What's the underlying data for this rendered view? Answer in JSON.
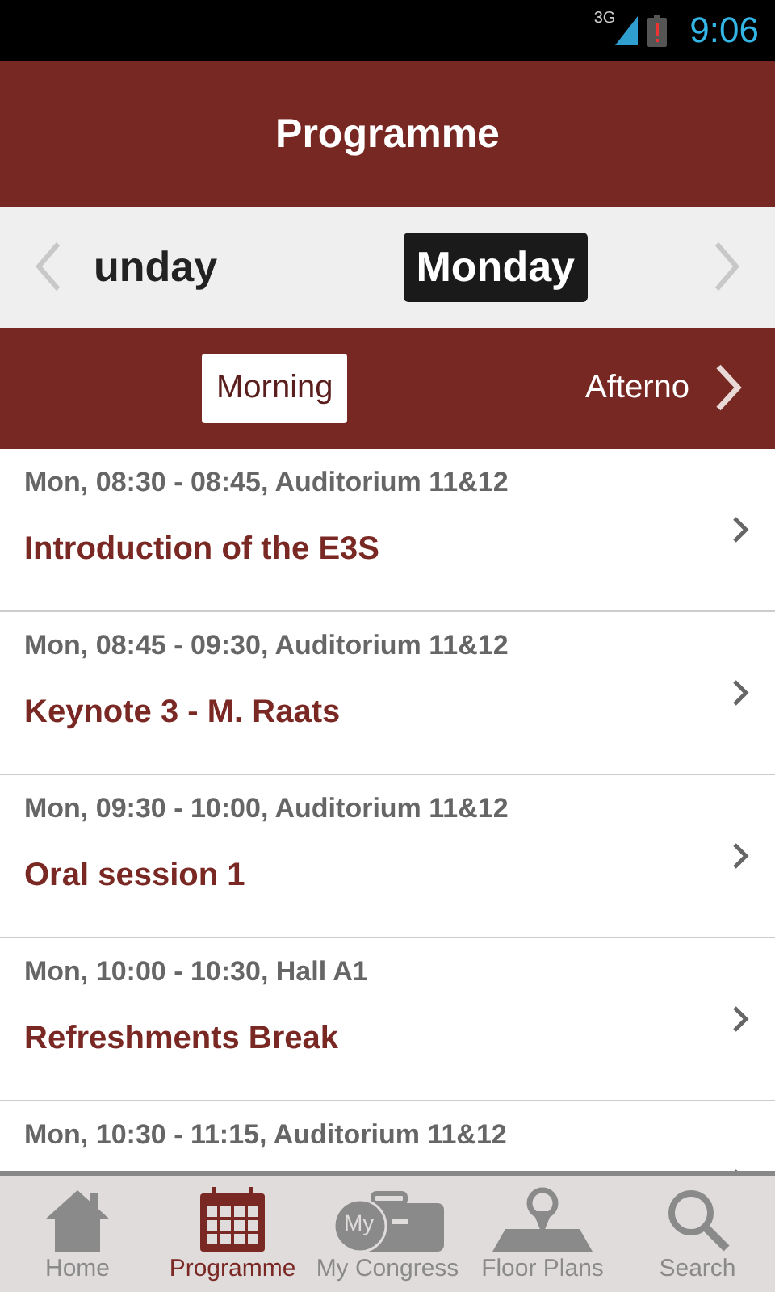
{
  "status_bar": {
    "network": "3G",
    "time": "9:06"
  },
  "header": {
    "title": "Programme"
  },
  "days": [
    {
      "label": "unday",
      "selected": false
    },
    {
      "label": "Monday",
      "selected": true
    }
  ],
  "sessions": [
    {
      "label": "Morning",
      "selected": true
    },
    {
      "label": "Afterno",
      "selected": false
    }
  ],
  "events": [
    {
      "meta": "Mon, 08:30 - 08:45, Auditorium 11&12",
      "title": "Introduction of the E3S"
    },
    {
      "meta": "Mon, 08:45 - 09:30, Auditorium 11&12",
      "title": "Keynote 3 - M. Raats"
    },
    {
      "meta": "Mon, 09:30 - 10:00, Auditorium 11&12",
      "title": "Oral session 1"
    },
    {
      "meta": "Mon, 10:00 - 10:30, Hall A1",
      "title": "Refreshments Break"
    },
    {
      "meta": "Mon, 10:30 - 11:15, Auditorium 11&12"
    }
  ],
  "tabs": [
    {
      "kind": "home",
      "label": "Home",
      "selected": false
    },
    {
      "kind": "calendar",
      "label": "Programme",
      "selected": true
    },
    {
      "kind": "briefcase",
      "label": "My Congress",
      "icon_text": "My",
      "selected": false
    },
    {
      "kind": "map",
      "label": "Floor Plans",
      "selected": false
    },
    {
      "kind": "search",
      "label": "Search",
      "selected": false
    }
  ]
}
